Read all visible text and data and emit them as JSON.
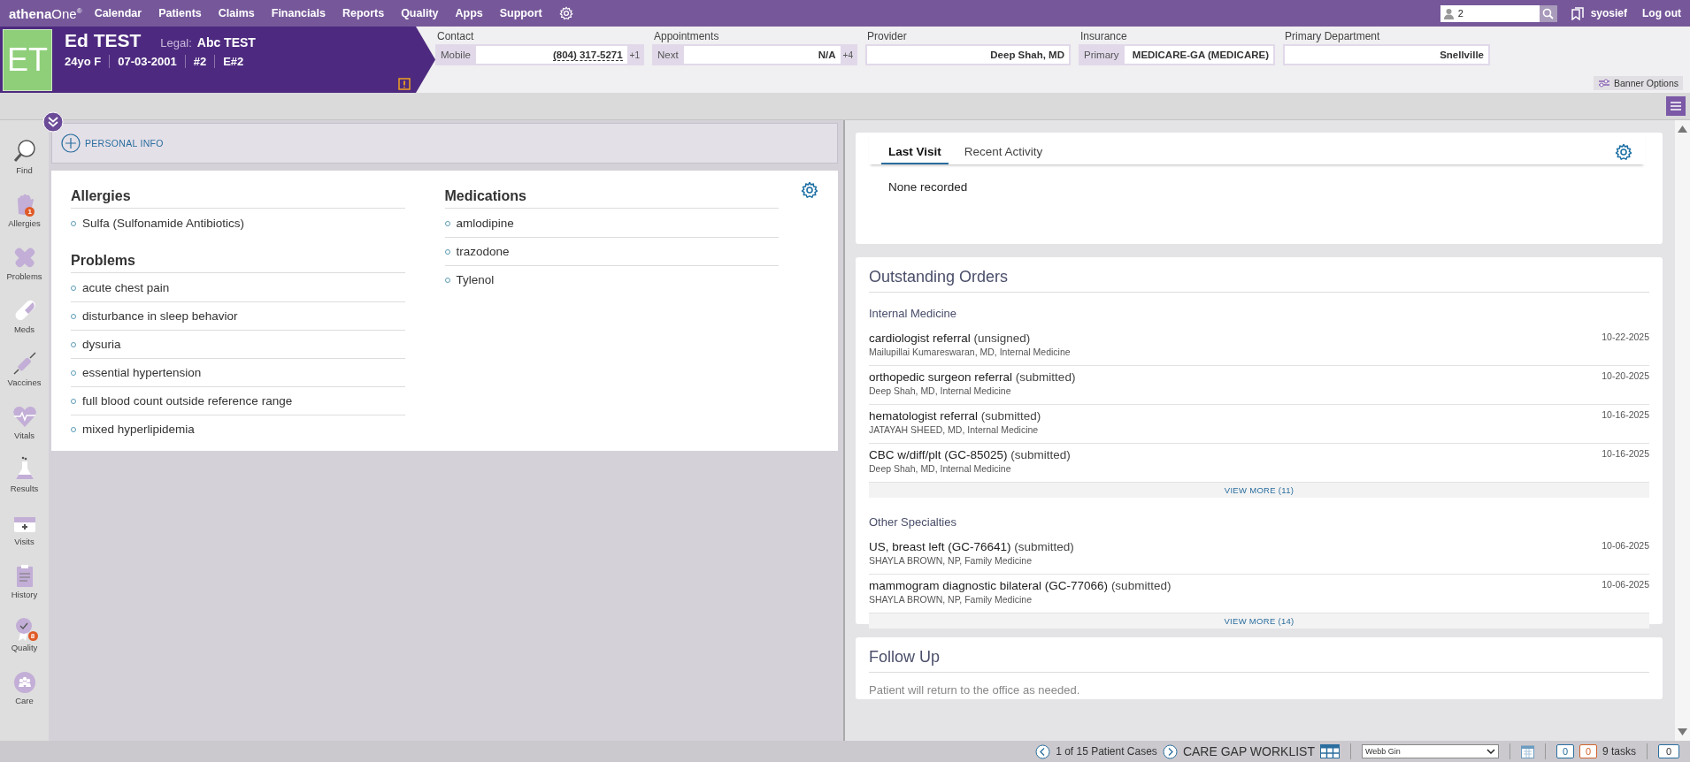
{
  "top_nav": {
    "logo": "**athena**One$^{®}$",
    "items": [
      "Calendar",
      "Patients",
      "Claims",
      "Financials",
      "Reports",
      "Quality",
      "Apps",
      "Support"
    ],
    "search": {
      "value": "2"
    },
    "user": "syosief",
    "logout": "Log out"
  },
  "patient": {
    "initials": "ET",
    "name": "Ed TEST",
    "legal_label": "Legal:",
    "legal_name": "Abc TEST",
    "details": [
      "24yo F",
      "07-03-2001",
      "#2",
      "E#2"
    ]
  },
  "banner_fields": [
    {
      "label": "Contact",
      "tag": "Mobile",
      "value": "(804) 317-5271",
      "extra": "+1"
    },
    {
      "label": "Appointments",
      "tag": "Next",
      "value": "N/A",
      "extra": "+4"
    },
    {
      "label": "Provider",
      "value": "Deep Shah, MD"
    },
    {
      "label": "Insurance",
      "tag": "Primary",
      "value": "MEDICARE-GA (MEDICARE)"
    },
    {
      "label": "Primary Department",
      "value": "Snellville"
    }
  ],
  "banner_options": "Banner Options",
  "sidebar": [
    {
      "kind": "find",
      "label": "Find"
    },
    {
      "kind": "allergies",
      "label": "Allergies",
      "badge": "1"
    },
    {
      "kind": "problems",
      "label": "Problems"
    },
    {
      "kind": "meds",
      "label": "Meds"
    },
    {
      "kind": "vaccines",
      "label": "Vaccines"
    },
    {
      "kind": "vitals",
      "label": "Vitals"
    },
    {
      "kind": "results",
      "label": "Results"
    },
    {
      "kind": "visits",
      "label": "Visits"
    },
    {
      "kind": "history",
      "label": "History"
    },
    {
      "kind": "quality",
      "label": "Quality",
      "badge": "8"
    },
    {
      "kind": "care",
      "label": "Care"
    }
  ],
  "personal_info": "PERSONAL INFO",
  "summary": {
    "columns": [
      {
        "sections": [
          {
            "title": "Allergies",
            "items": [
              "Sulfa (Sulfonamide Antibiotics)"
            ]
          },
          {
            "title": "Problems",
            "items": [
              "acute chest pain",
              "disturbance in sleep behavior",
              "dysuria",
              "essential hypertension",
              "full blood count outside reference range",
              "mixed hyperlipidemia"
            ]
          }
        ]
      },
      {
        "sections": [
          {
            "title": "Medications",
            "items": [
              "amlodipine",
              "trazodone",
              "Tylenol"
            ]
          }
        ]
      }
    ]
  },
  "last_visit": {
    "tabs": [
      {
        "label": "Last Visit",
        "selected": true
      },
      {
        "label": "Recent Activity",
        "selected": false
      }
    ],
    "message": "None recorded"
  },
  "outstanding_orders": {
    "title": "Outstanding Orders",
    "groups": [
      {
        "title": "Internal Medicine",
        "view_more": "VIEW MORE (11)",
        "orders": [
          {
            "name": "cardiologist referral",
            "status": "(unsigned)",
            "by": "Mailupillai Kumareswaran, MD, Internal Medicine",
            "date": "10-22-2025"
          },
          {
            "name": "orthopedic surgeon referral",
            "status": "(submitted)",
            "by": "Deep Shah, MD, Internal Medicine",
            "date": "10-20-2025"
          },
          {
            "name": "hematologist referral",
            "status": "(submitted)",
            "by": "JATAYAH SHEED, MD, Internal Medicine",
            "date": "10-16-2025"
          },
          {
            "name": "CBC w/diff/plt (GC-85025)",
            "status": "(submitted)",
            "by": "Deep Shah, MD, Internal Medicine",
            "date": "10-16-2025"
          }
        ]
      },
      {
        "title": "Other Specialties",
        "view_more": "VIEW MORE (14)",
        "orders": [
          {
            "name": "US, breast left (GC-76641)",
            "status": "(submitted)",
            "by": "SHAYLA BROWN, NP, Family Medicine",
            "date": "10-06-2025"
          },
          {
            "name": "mammogram diagnostic bilateral (GC-77066)",
            "status": "(submitted)",
            "by": "SHAYLA BROWN, NP, Family Medicine",
            "date": "10-06-2025"
          }
        ]
      }
    ]
  },
  "follow_up": {
    "title": "Follow Up",
    "text": "Patient will return to the office as needed."
  },
  "status_bar": {
    "cases": "1 of 15 Patient Cases",
    "worklist": "CARE GAP WORKLIST",
    "dropdown": "Webb Gin",
    "counts": [
      {
        "value": "0",
        "color": "#2a6e9e"
      },
      {
        "value": "0",
        "color": "#d0642c"
      }
    ],
    "tasks": "9 tasks",
    "messages": "0"
  }
}
